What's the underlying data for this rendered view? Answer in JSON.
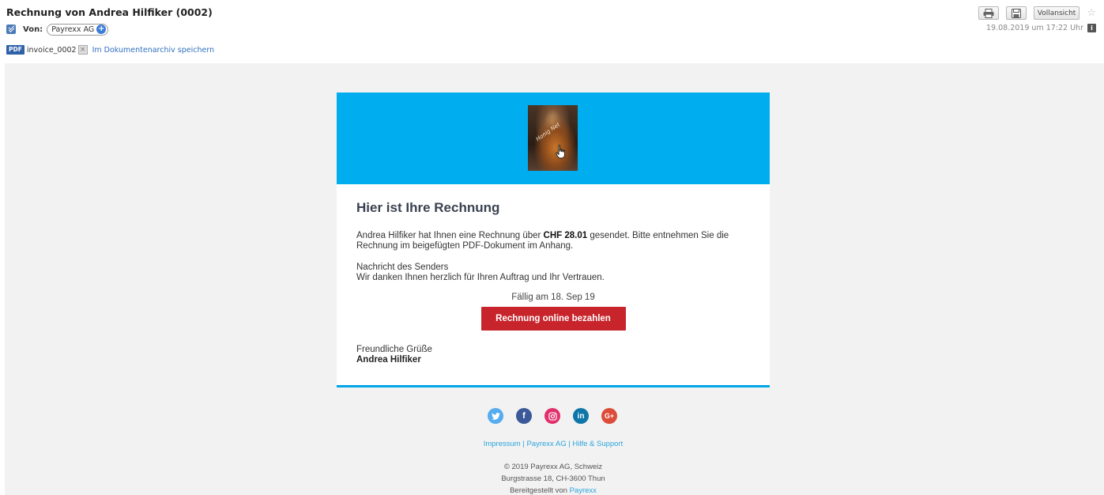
{
  "header": {
    "subject": "Rechnung von Andrea Hilfiker (0002)",
    "from_label": "Von:",
    "sender": "Payrexx AG",
    "date": "19.08.2019 um 17:22 Uhr",
    "attachment": {
      "type_badge": "PDF",
      "name": "invoice_0002",
      "archive_link": "Im Dokumentenarchiv speichern"
    },
    "toolbar": {
      "print_icon": "printer-icon",
      "save_icon": "floppy-icon",
      "fullview_label": "Vollansicht",
      "star_icon": "star-icon"
    }
  },
  "email": {
    "banner_color": "#00aeef",
    "logo_text": "Honig Net",
    "heading": "Hier ist Ihre Rechnung",
    "para_prefix": "Andrea Hilfiker hat Ihnen eine Rechnung über ",
    "amount": "CHF 28.01",
    "para_suffix": " gesendet. Bitte entnehmen Sie die Rechnung im beigefügten PDF-Dokument im Anhang.",
    "message_label": "Nachricht des Senders",
    "message_text": "Wir danken Ihnen herzlich für Ihren Auftrag und Ihr Vertrauen.",
    "due": "Fällig am 18. Sep 19",
    "pay_button": "Rechnung online bezahlen",
    "pay_button_color": "#c8242c",
    "greeting": "Freundliche Grüße",
    "signer": "Andrea Hilfiker"
  },
  "footer": {
    "social": [
      "twitter-icon",
      "facebook-icon",
      "instagram-icon",
      "linkedin-icon",
      "google-plus-icon"
    ],
    "social_glyphs": {
      "fb": "f",
      "li": "in",
      "gp": "G+"
    },
    "links": [
      "Impressum",
      "Payrexx AG",
      "Hilfe & Support"
    ],
    "link_separator": "|",
    "copyright": "© 2019 Payrexx AG, Schweiz",
    "address": "Burgstrasse 18, CH-3600 Thun",
    "provided_prefix": "Bereitgestellt von",
    "provided_link": "Payrexx"
  }
}
